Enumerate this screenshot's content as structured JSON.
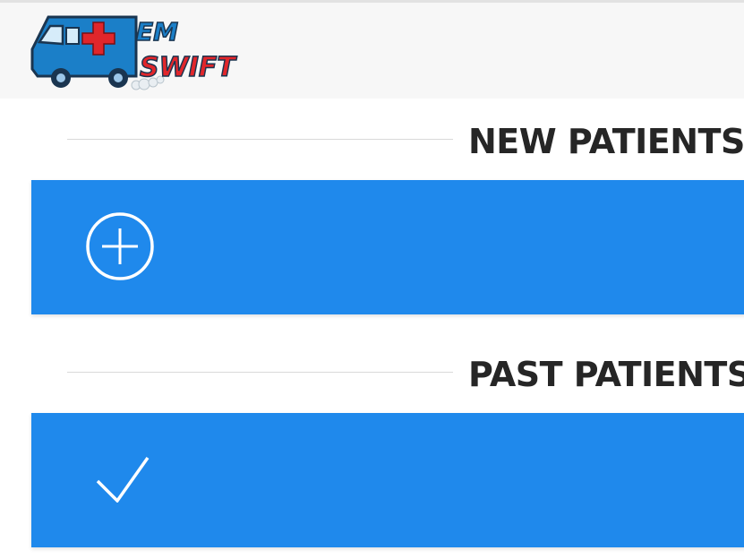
{
  "header": {
    "logo": {
      "line1": "EM",
      "line2": "SWIFT",
      "icon": "ambulance-logo",
      "colors": {
        "vehicle": "#1b7fc8",
        "outline": "#1a3550",
        "cross": "#e1262b",
        "text_top": "#1b7fc8",
        "text_bottom": "#e1262b"
      }
    }
  },
  "sections": {
    "new": {
      "title": "NEW PATIENTS",
      "card_icon": "plus-circle-icon"
    },
    "past": {
      "title": "PAST PATIENTS",
      "card_icon": "checkmark-icon"
    }
  },
  "theme": {
    "accent": "#1f89ec",
    "heading_color": "#262626",
    "header_bg": "#f7f7f7"
  }
}
